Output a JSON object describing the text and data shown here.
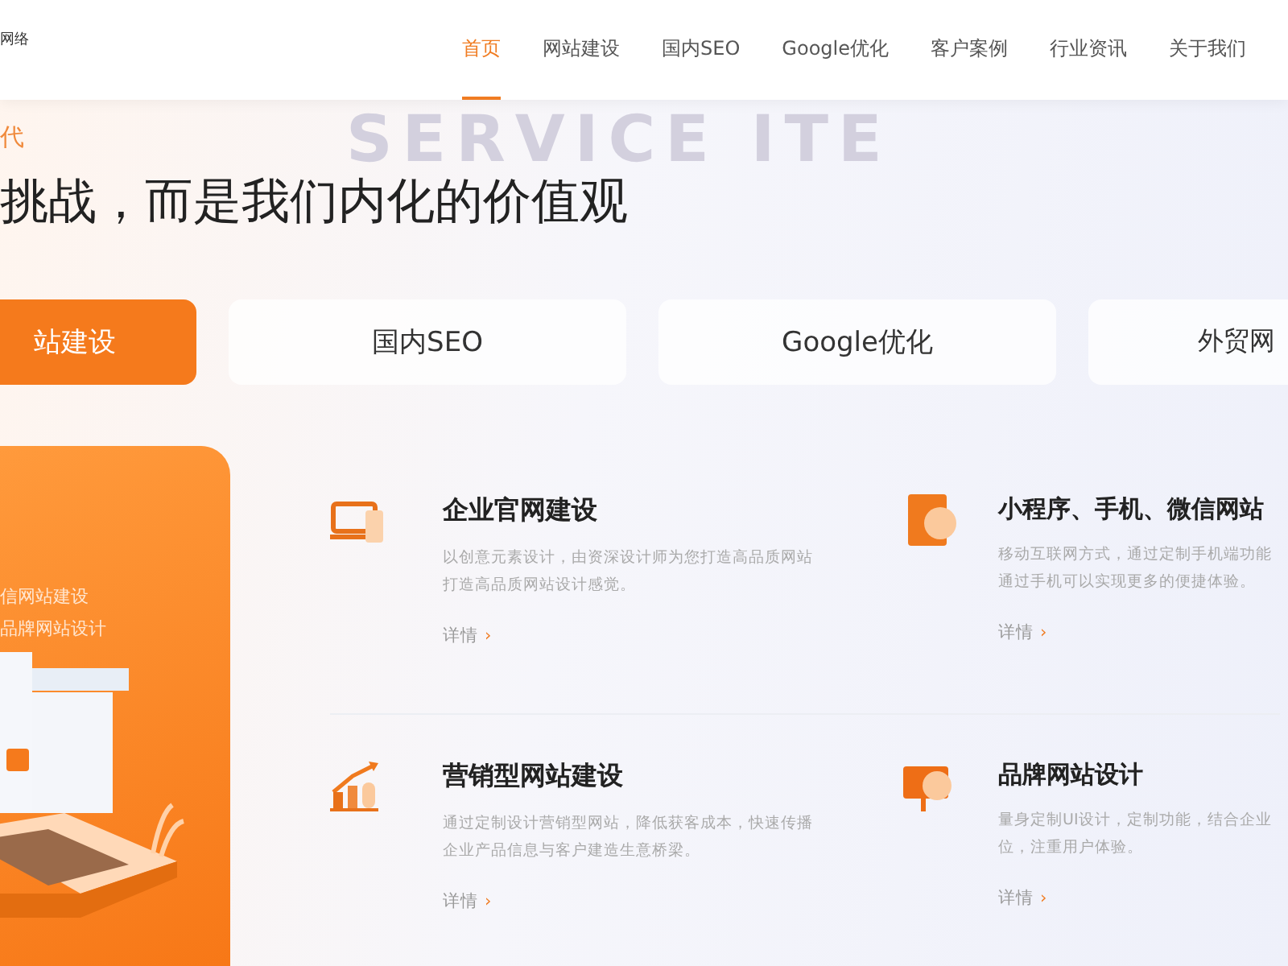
{
  "header": {
    "logo_text": "网络",
    "nav": [
      {
        "label": "首页",
        "selected": true
      },
      {
        "label": "网站建设",
        "selected": false
      },
      {
        "label": "国内SEO",
        "selected": false
      },
      {
        "label": "Google优化",
        "selected": false
      },
      {
        "label": "客户案例",
        "selected": false
      },
      {
        "label": "行业资讯",
        "selected": false
      },
      {
        "label": "关于我们",
        "selected": false
      }
    ]
  },
  "hero": {
    "background_text": "SERVICE ITE",
    "kicker": "代",
    "heading": "挑战，而是我们内化的价值观"
  },
  "tabs": [
    {
      "label": "站建设",
      "selected": true
    },
    {
      "label": "国内SEO",
      "selected": false
    },
    {
      "label": "Google优化",
      "selected": false
    },
    {
      "label": "外贸网",
      "selected": false
    }
  ],
  "feature_card": {
    "lines": [
      "信网站建设",
      "品牌网站设计"
    ]
  },
  "services": [
    {
      "kind": "desktop",
      "title": "企业官网建设",
      "description": "以创意元素设计，由资深设计师为您打造高品质网站打造高品质网站设计感觉。",
      "link": "详情",
      "arrow": "›"
    },
    {
      "kind": "mobile",
      "title": "小程序、手机、微信网站",
      "description": "移动互联网方式，通过定制手机端功能通过手机可以实现更多的便捷体验。",
      "link": "详情",
      "arrow": "›"
    },
    {
      "kind": "chart",
      "title": "营销型网站建设",
      "description": "通过定制设计营销型网站，降低获客成本，快速传播企业产品信息与客户建造生意桥梁。",
      "link": "详情",
      "arrow": "›"
    },
    {
      "kind": "brand",
      "title": "品牌网站设计",
      "description": "量身定制UI设计，定制功能，结合企业位，注重用户体验。",
      "link": "详情",
      "arrow": "›"
    }
  ]
}
